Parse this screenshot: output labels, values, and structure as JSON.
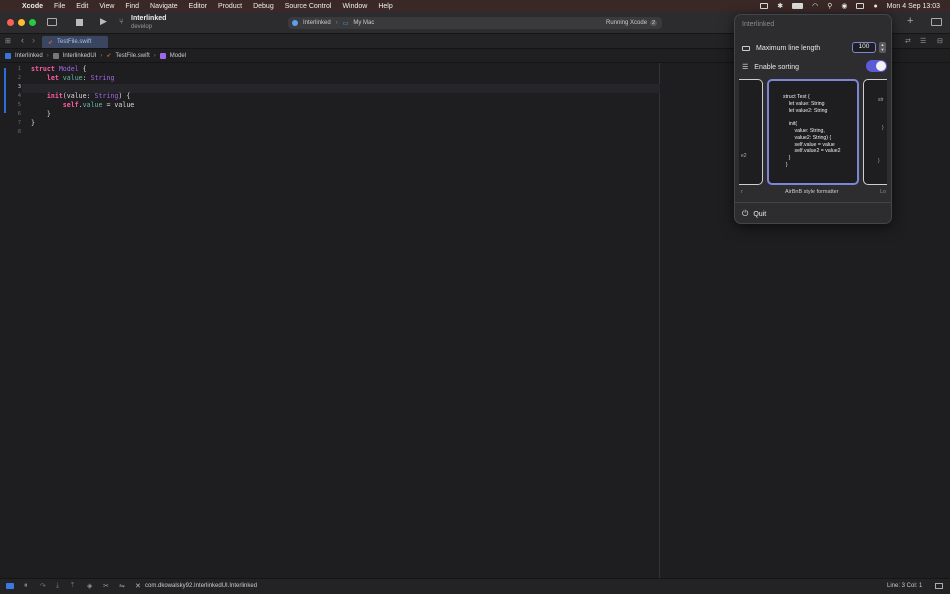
{
  "menubar": {
    "app": "Xcode",
    "items": [
      "File",
      "Edit",
      "View",
      "Find",
      "Navigate",
      "Editor",
      "Product",
      "Debug",
      "Source Control",
      "Window",
      "Help"
    ],
    "clock": "Mon 4 Sep  13:03"
  },
  "toolbar": {
    "project_name": "Interlinked",
    "branch": "develop",
    "scheme": "Interlinked",
    "destination": "My Mac",
    "activity": "Running Xcode",
    "activity_count": "2"
  },
  "tab": {
    "label": "TestFile.swift"
  },
  "breadcrumb": [
    "Interlinked",
    "InterlinkedUI",
    "TestFile.swift",
    "Model"
  ],
  "editor": {
    "line_numbers": [
      "1",
      "2",
      "3",
      "4",
      "5",
      "6",
      "7",
      "8"
    ],
    "current_line": 3
  },
  "popover": {
    "title": "Interlinked",
    "max_line_length_label": "Maximum line length",
    "max_line_length_value": "100",
    "enable_sorting_label": "Enable sorting",
    "enable_sorting_on": true,
    "formatter_caption": "AirBnB style formatter",
    "formatter_preview": "struct Test {\n    let value: String\n    let value2: String\n\n    init(\n        value: String,\n        value2: String) {\n        self.value = value\n        self.value2 = value2\n    }\n  }",
    "left_card_fragment": "e2",
    "right_card_fragments": [
      "str",
      "}",
      "}"
    ],
    "left_cap_fragment": "r",
    "right_cap_fragment": "Lo",
    "quit_label": "Quit"
  },
  "status": {
    "target": "com.dkowalsky92.InterlinkedUI.Interlinked",
    "position": "Line: 3  Col: 1"
  }
}
